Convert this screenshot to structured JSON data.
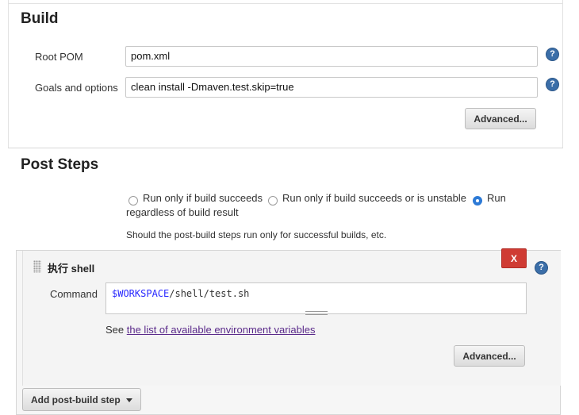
{
  "build": {
    "title": "Build",
    "root_pom_label": "Root POM",
    "root_pom_value": "pom.xml",
    "goals_label": "Goals and options",
    "goals_value": "clean install -Dmaven.test.skip=true",
    "advanced_label": "Advanced..."
  },
  "post_steps": {
    "title": "Post Steps",
    "radio_options": [
      {
        "label": "Run only if build succeeds",
        "checked": false
      },
      {
        "label": "Run only if build succeeds or is unstable",
        "checked": false
      },
      {
        "label": "Run",
        "checked": true
      }
    ],
    "radio_option_3_cont": "regardless of build result",
    "description": "Should the post-build steps run only for successful builds, etc.",
    "step": {
      "title": "执行 shell",
      "delete_label": "X",
      "command_label": "Command",
      "command_var": "$WORKSPACE",
      "command_rest": "/shell/test.sh",
      "see_prefix": "See ",
      "see_link": "the list of available environment variables",
      "advanced_label": "Advanced..."
    },
    "add_step_label": "Add post-build step"
  },
  "help_glyph": "?"
}
